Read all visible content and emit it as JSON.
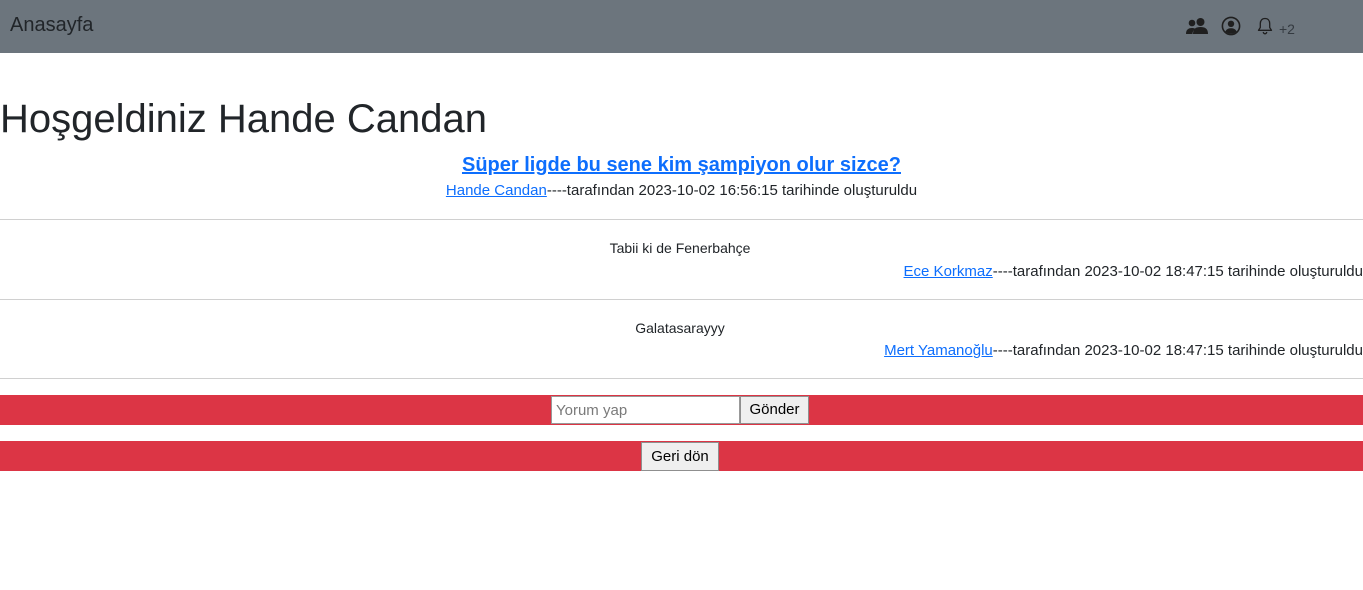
{
  "navbar": {
    "brand": "Anasayfa",
    "icons": [
      "people-icon",
      "person-circle-icon",
      "bell-icon"
    ],
    "notification_count": "+2",
    "background": "#6c757d"
  },
  "page": {
    "title": "Hoşgeldiniz Hande Candan"
  },
  "post": {
    "question": "Süper ligde bu sene kim şampiyon olur sizce?",
    "author": "Hande Candan",
    "meta_text": "----tarafından 2023-10-02 16:56:15 tarihinde oluşturuldu"
  },
  "comments": [
    {
      "text": "Tabii ki de Fenerbahçe",
      "author": "Ece Korkmaz",
      "meta_text": "----tarafından 2023-10-02 18:47:15 tarihinde oluşturuldu"
    },
    {
      "text": "Galatasarayyy",
      "author": "Mert Yamanoğlu",
      "meta_text": "----tarafından 2023-10-02 18:47:15 tarihinde oluşturuldu"
    }
  ],
  "comment_form": {
    "placeholder": "Yorum yap",
    "value": "",
    "submit_label": "Gönder"
  },
  "back": {
    "label": "Geri dön"
  },
  "colors": {
    "accent_bar": "#dc3545",
    "link": "#0d6efd"
  }
}
